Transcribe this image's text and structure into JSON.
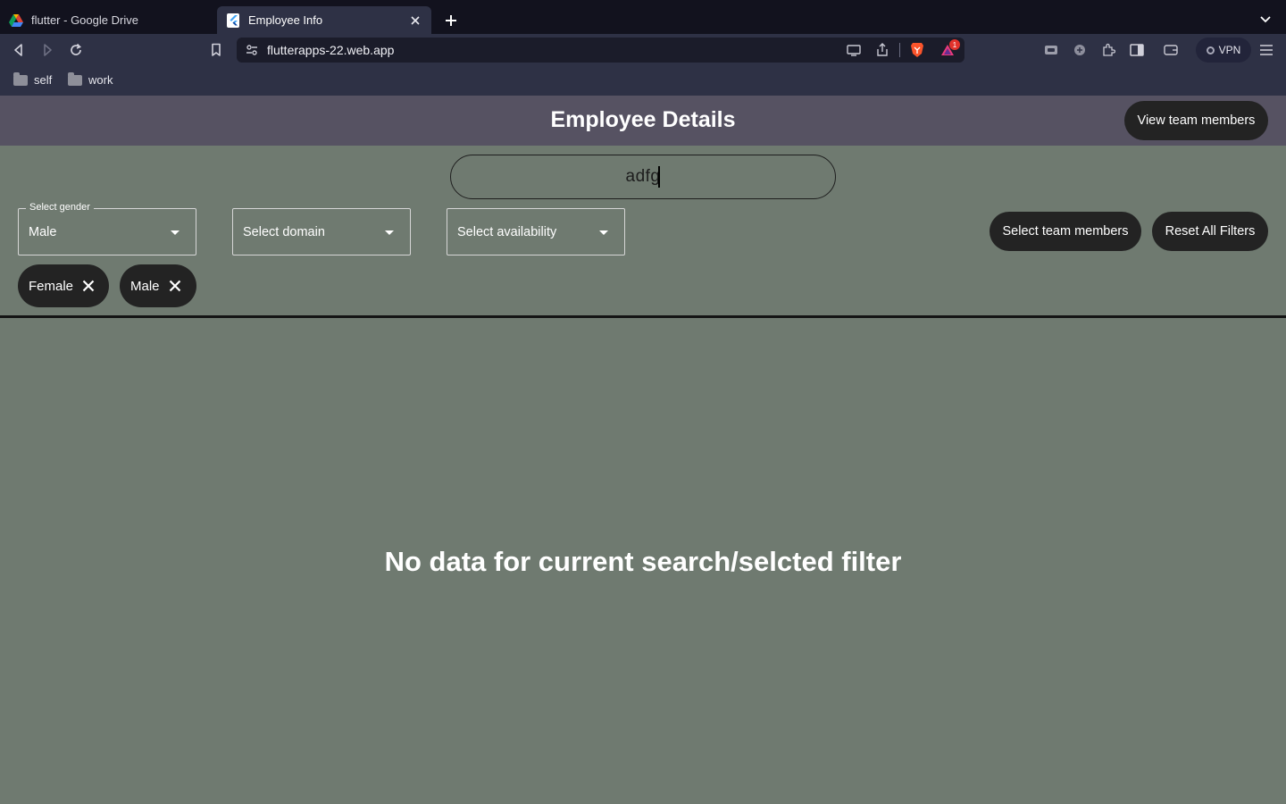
{
  "browser": {
    "tabs": [
      {
        "title": "flutter - Google Drive",
        "favicon": "google-drive-icon",
        "active": false
      },
      {
        "title": "Employee Info",
        "favicon": "flutter-icon",
        "active": true
      }
    ],
    "url": "flutterapps-22.web.app",
    "shield_badge": "1",
    "vpn_label": "VPN",
    "bookmarks": [
      {
        "label": "self",
        "icon": "folder-icon"
      },
      {
        "label": "work",
        "icon": "folder-icon"
      }
    ]
  },
  "app": {
    "title": "Employee Details",
    "view_team_label": "View team members",
    "search": {
      "value": "adfg"
    },
    "filters": {
      "gender": {
        "floating_label": "Select gender",
        "value": "Male"
      },
      "domain": {
        "value": "Select domain"
      },
      "availability": {
        "value": "Select availability"
      }
    },
    "select_team_label": "Select team members",
    "reset_label": "Reset All Filters",
    "chips": [
      {
        "label": "Female"
      },
      {
        "label": "Male"
      }
    ],
    "empty_message": "No data for current search/selcted filter"
  },
  "colors": {
    "page_bg": "#6f7a70",
    "appbar_bg": "#565262",
    "button_bg": "#232323",
    "browser_dark": "#12121e",
    "browser_toolbar": "#2e3145"
  }
}
